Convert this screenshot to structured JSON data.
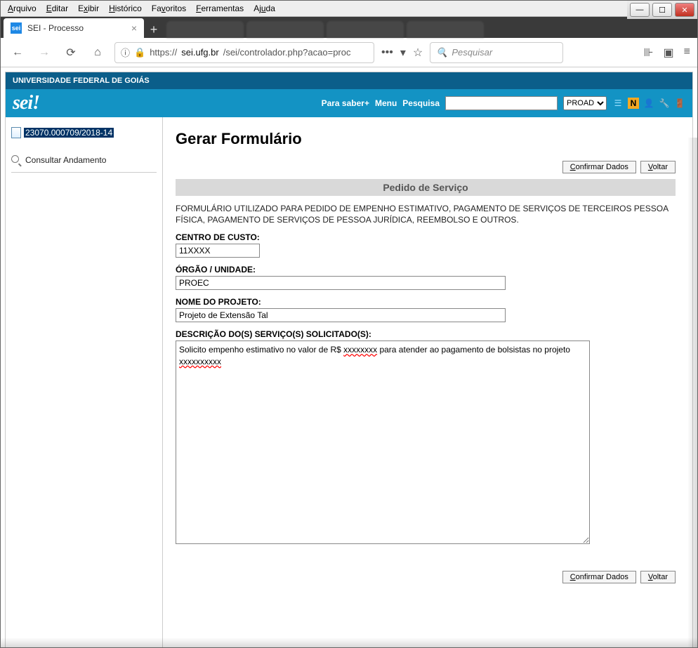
{
  "menubar": [
    "Arquivo",
    "Editar",
    "Exibir",
    "Histórico",
    "Favoritos",
    "Ferramentas",
    "Ajuda"
  ],
  "tab": {
    "title": "SEI - Processo",
    "favicon": "sei"
  },
  "url": {
    "scheme": "https://",
    "host": "sei.ufg.br",
    "path": "/sei/controlador.php?acao=proc"
  },
  "search_placeholder": "Pesquisar",
  "university": "UNIVERSIDADE FEDERAL DE GOIÁS",
  "sei_logo": "sei!",
  "topnav": {
    "para_saber": "Para saber+",
    "menu": "Menu",
    "pesquisa": "Pesquisa"
  },
  "unit_select": "PROAD",
  "sidebar": {
    "processo": "23070.000709/2018-14",
    "consultar": "Consultar Andamento"
  },
  "main": {
    "title": "Gerar Formulário",
    "btn_confirmar": "Confirmar Dados",
    "btn_voltar": "Voltar",
    "form_header": "Pedido de Serviço",
    "description": "FORMULÁRIO UTILIZADO PARA PEDIDO DE EMPENHO ESTIMATIVO, PAGAMENTO DE SERVIÇOS DE TERCEIROS PESSOA FÍSICA, PAGAMENTO DE SERVIÇOS DE PESSOA JURÍDICA, REEMBOLSO E OUTROS.",
    "f1_label": "CENTRO DE CUSTO:",
    "f1_value": "11XXXX",
    "f2_label": "ÓRGÃO / UNIDADE:",
    "f2_value": "PROEC",
    "f3_label": "NOME DO PROJETO:",
    "f3_value": "Projeto de Extensão Tal",
    "f4_label": "DESCRIÇÃO DO(S) SERVIÇO(S) SOLICITADO(S):",
    "f4_part1": "Solicito empenho estimativo no valor de R$ ",
    "f4_err1": "xxxxxxxx",
    "f4_part2": " para atender ao pagamento de bolsistas no projeto ",
    "f4_err2": "xxxxxxxxxx"
  }
}
